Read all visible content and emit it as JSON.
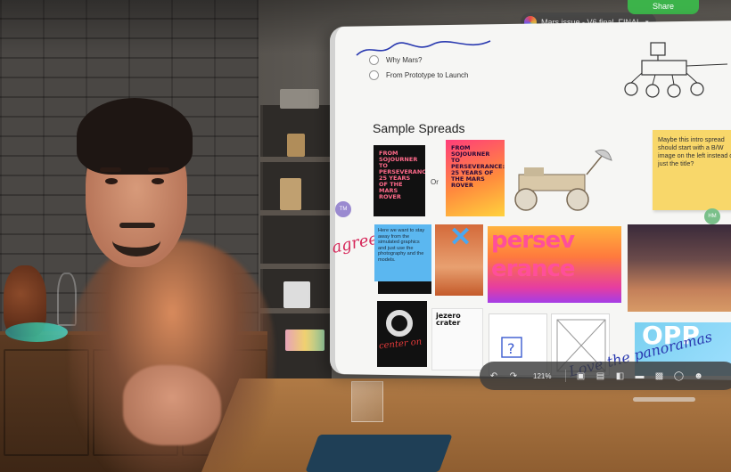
{
  "document": {
    "title": "Mars issue - V6 final_FINAL",
    "share_label": "Share"
  },
  "outline": {
    "items": [
      "Why Mars?",
      "From Prototype to Launch"
    ]
  },
  "canvas": {
    "section_title": "Sample Spreads",
    "or_label": "Or",
    "spread_card_text": "From Sojourner to Perseverance: 25 years of the Mars Rover",
    "spread_card_text_2": "From Sojourner to Perseverance: 25 years of the Mars Rover",
    "sticky_note": "Maybe this intro spread should start with a B/W image on the left instead of just the title?",
    "blue_sticky": "Here we want to stay away from the simulated graphics and just use the photography and the models.",
    "agree_note": "agree!",
    "persev_text_1": "persev",
    "persev_text_2": "erance",
    "jezero_title": "Jezero Crater",
    "opp_text": "OPP",
    "love_note": "Love the panoramas",
    "center_note": "center on",
    "avatar_left": "TM",
    "avatar_right": "HM"
  },
  "toolbar": {
    "zoom": "121%"
  },
  "colors": {
    "accent_green": "#3cb34a",
    "sticky_yellow": "#f8d76a",
    "sticky_blue": "#5bb7f0",
    "note_red": "#d6285a",
    "note_blue": "#2a3ab0"
  },
  "icons": {
    "undo": "undo-icon",
    "redo": "redo-icon",
    "sticky": "sticky-note-icon",
    "text": "text-box-icon",
    "shapes": "shapes-icon",
    "media": "media-icon",
    "folder": "folder-icon",
    "collaborators": "collaborators-icon"
  }
}
